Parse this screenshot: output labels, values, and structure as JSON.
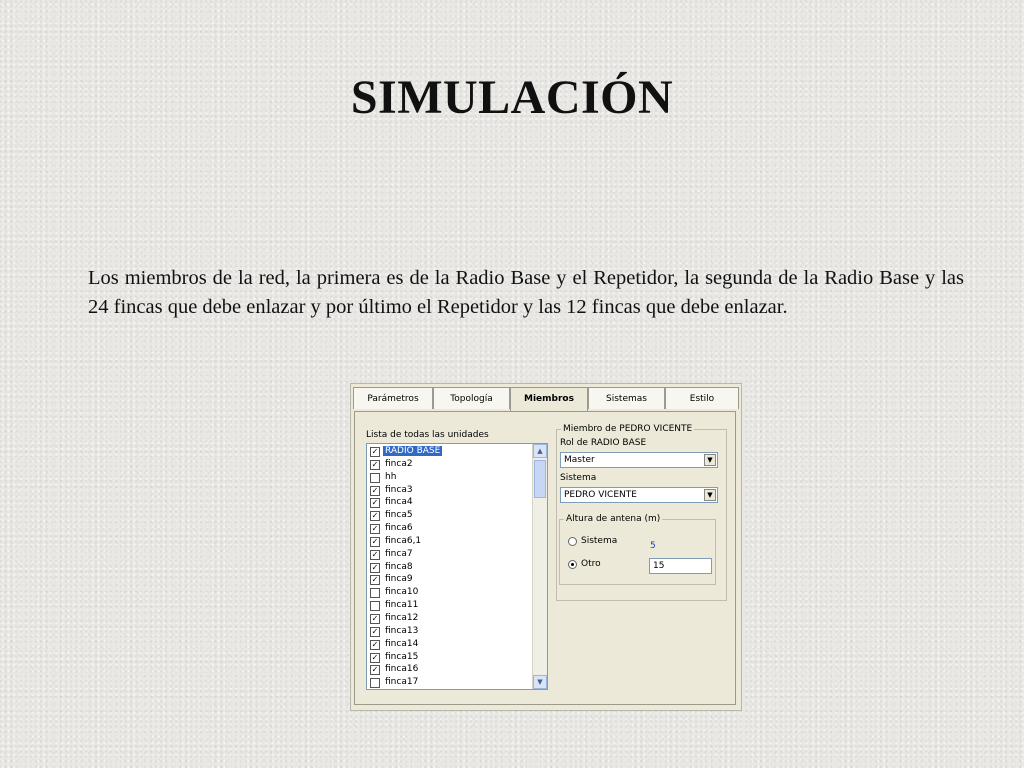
{
  "slide": {
    "title": "SIMULACIÓN",
    "paragraph": "Los miembros de la red, la primera es de la Radio Base y el Repetidor, la segunda de la Radio Base y las 24 fincas que debe enlazar y por último el Repetidor y las 12 fincas que debe enlazar."
  },
  "dialog": {
    "tabs": [
      {
        "label": "Parámetros",
        "active": false
      },
      {
        "label": "Topología",
        "active": false
      },
      {
        "label": "Miembros",
        "active": true
      },
      {
        "label": "Sistemas",
        "active": false
      },
      {
        "label": "Estilo",
        "active": false
      }
    ],
    "list_label": "Lista de todas las unidades",
    "units": [
      {
        "name": "RADIO BASE",
        "checked": true,
        "selected": true
      },
      {
        "name": "finca2",
        "checked": true
      },
      {
        "name": "hh",
        "checked": false
      },
      {
        "name": "finca3",
        "checked": true
      },
      {
        "name": "finca4",
        "checked": true
      },
      {
        "name": "finca5",
        "checked": true
      },
      {
        "name": "finca6",
        "checked": true
      },
      {
        "name": "finca6,1",
        "checked": true
      },
      {
        "name": "finca7",
        "checked": true
      },
      {
        "name": "finca8",
        "checked": true
      },
      {
        "name": "finca9",
        "checked": true
      },
      {
        "name": "finca10",
        "checked": false
      },
      {
        "name": "finca11",
        "checked": false
      },
      {
        "name": "finca12",
        "checked": true
      },
      {
        "name": "finca13",
        "checked": true
      },
      {
        "name": "finca14",
        "checked": true
      },
      {
        "name": "finca15",
        "checked": true
      },
      {
        "name": "finca16",
        "checked": true
      },
      {
        "name": "finca17",
        "checked": false
      }
    ],
    "member_group_title": "Miembro de PEDRO VICENTE",
    "role_label": "Rol de RADIO BASE",
    "role_value": "Master",
    "system_label": "Sistema",
    "system_value": "PEDRO VICENTE",
    "antenna_group_title": "Altura de antena (m)",
    "radio_sistema_label": "Sistema",
    "radio_sistema_value": "5",
    "radio_otro_label": "Otro",
    "radio_otro_value": "15",
    "selected_radio": "Otro",
    "colors": {
      "selection": "#316ac5",
      "value_blue": "#1a3fb0"
    }
  }
}
